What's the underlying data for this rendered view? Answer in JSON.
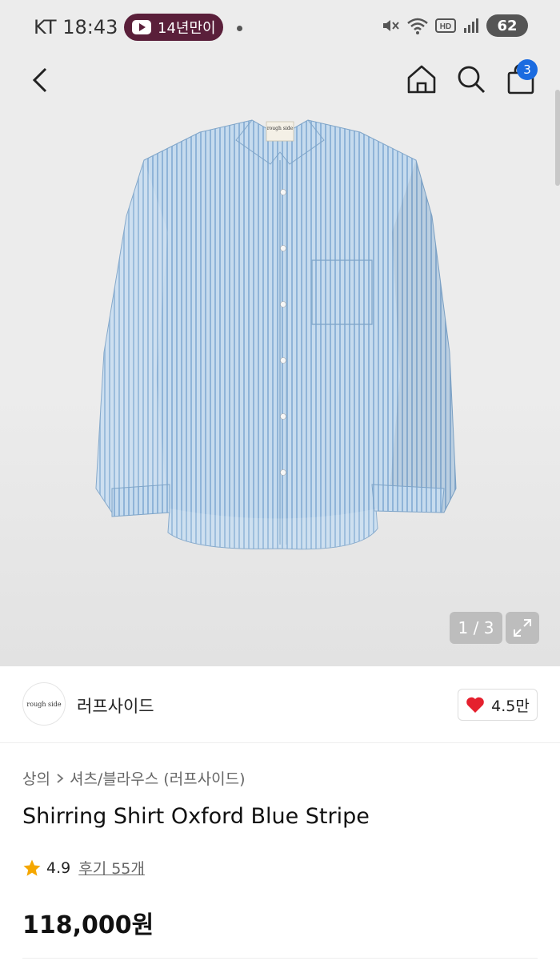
{
  "status_bar": {
    "carrier": "KT",
    "time": "18:43",
    "notification_pill": "14년만이",
    "battery": "62"
  },
  "header": {
    "cart_count": "3"
  },
  "gallery": {
    "counter": "1 / 3",
    "shirt_label": "rough side"
  },
  "brand": {
    "logo_text": "rough side",
    "name": "러프사이드",
    "likes": "4.5만"
  },
  "product": {
    "breadcrumb": [
      "상의",
      "셔츠/블라우스 (러프사이드)"
    ],
    "title": "Shirring Shirt Oxford Blue Stripe",
    "rating": "4.9",
    "reviews": "후기 55개",
    "price": "118,000원"
  },
  "colors": {
    "accent": "#1a6be0",
    "heart": "#e5202e",
    "star": "#f5a700",
    "shirt": "#a8c6e2"
  }
}
